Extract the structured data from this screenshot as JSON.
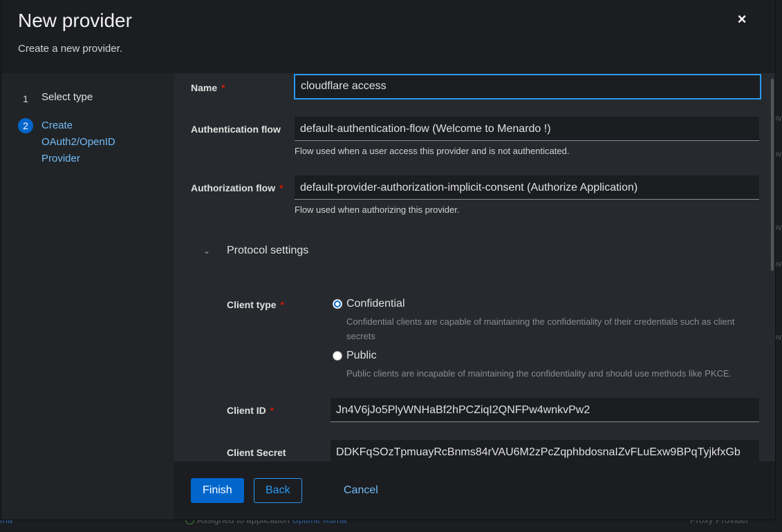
{
  "modal": {
    "title": "New provider",
    "subtitle": "Create a new provider.",
    "close_icon": "×"
  },
  "wizard_nav": {
    "steps": [
      {
        "number": "1",
        "label": "Select type"
      },
      {
        "number": "2",
        "label": "Create OAuth2/OpenID Provider"
      }
    ]
  },
  "form": {
    "name": {
      "label": "Name",
      "value": "cloudflare access"
    },
    "authentication_flow": {
      "label": "Authentication flow",
      "value": "default-authentication-flow (Welcome to Menardo !)",
      "helper": "Flow used when a user access this provider and is not authenticated."
    },
    "authorization_flow": {
      "label": "Authorization flow",
      "value": "default-provider-authorization-implicit-consent (Authorize Application)",
      "helper": "Flow used when authorizing this provider."
    },
    "protocol_settings": {
      "title": "Protocol settings",
      "chevron_icon": "⌄",
      "client_type": {
        "label": "Client type",
        "options": [
          {
            "label": "Confidential",
            "description": "Confidential clients are capable of maintaining the confidentiality of their credentials such as client secrets",
            "selected": true
          },
          {
            "label": "Public",
            "description": "Public clients are incapable of maintaining the confidentiality and should use methods like PKCE.",
            "selected": false
          }
        ]
      },
      "client_id": {
        "label": "Client ID",
        "value": "Jn4V6jJo5PlyWNHaBf2hPCZiqI2QNFPw4wnkvPw2"
      },
      "client_secret": {
        "label": "Client Secret",
        "value": "DDKFqSOzTpmuayRcBnms84rVAU6M2zPcZqphbdosnaIZvFLuExw9BPqTyjkfxGb"
      }
    }
  },
  "footer": {
    "finish_label": "Finish",
    "back_label": "Back",
    "cancel_label": "Cancel"
  },
  "background": {
    "left_fragment": "ma",
    "assigned_text": "Assigned to application ",
    "assigned_app": "Uptime Kuma",
    "proxy_text": "Proxy Provider",
    "right_fragment": "ov"
  },
  "colors": {
    "accent": "#0066cc",
    "link": "#73bcf7",
    "required": "#c9190b",
    "focus_border": "#2b9af3"
  }
}
